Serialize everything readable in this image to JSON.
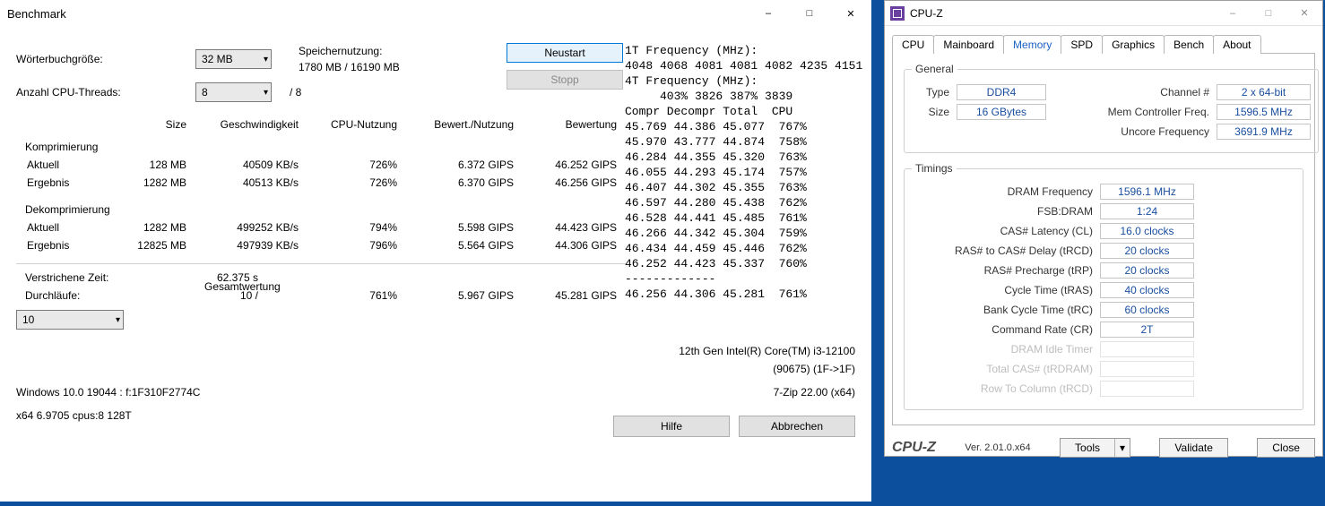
{
  "sevenzip": {
    "title": "Benchmark",
    "labels": {
      "dict": "Wörterbuchgröße:",
      "threads": "Anzahl CPU-Threads:",
      "mem_title": "Speichernutzung:",
      "mem_value": "1780 MB / 16190 MB",
      "threads_total": "/ 8",
      "neustart": "Neustart",
      "stopp": "Stopp",
      "hilfe": "Hilfe",
      "abbrechen": "Abbrechen",
      "elapsed": "Verstrichene Zeit:",
      "passes": "Durchläufe:",
      "total_rating": "Gesamtwertung"
    },
    "dict_value": "32 MB",
    "threads_value": "8",
    "passes_combo": "10",
    "headers": [
      "",
      "Size",
      "Geschwindigkeit",
      "CPU-Nutzung",
      "Bewert./Nutzung",
      "Bewertung"
    ],
    "sections": {
      "compress": "Komprimierung",
      "decompress": "Dekomprimierung"
    },
    "compress": [
      {
        "name": "Aktuell",
        "size": "128 MB",
        "speed": "40509 KB/s",
        "cpu": "726%",
        "rpu": "6.372 GIPS",
        "rating": "46.252 GIPS"
      },
      {
        "name": "Ergebnis",
        "size": "1282 MB",
        "speed": "40513 KB/s",
        "cpu": "726%",
        "rpu": "6.370 GIPS",
        "rating": "46.256 GIPS"
      }
    ],
    "decompress": [
      {
        "name": "Aktuell",
        "size": "1282 MB",
        "speed": "499252 KB/s",
        "cpu": "794%",
        "rpu": "5.598 GIPS",
        "rating": "44.423 GIPS"
      },
      {
        "name": "Ergebnis",
        "size": "12825 MB",
        "speed": "497939 KB/s",
        "cpu": "796%",
        "rpu": "5.564 GIPS",
        "rating": "44.306 GIPS"
      }
    ],
    "elapsed_value": "62.375 s",
    "passes_value": "10 /",
    "total": {
      "cpu": "761%",
      "rpu": "5.967 GIPS",
      "rating": "45.281 GIPS"
    },
    "cpuinfo1": "12th Gen Intel(R) Core(TM) i3-12100",
    "cpuinfo2": "(90675) (1F->1F)",
    "osinfo": "Windows 10.0 19044 : f:1F310F2774C",
    "zipver": "7-Zip 22.00 (x64)",
    "buildinfo": "x64 6.9705 cpus:8 128T",
    "log": "1T Frequency (MHz):\n4048 4068 4081 4081 4082 4235 4151\n4T Frequency (MHz):\n     403% 3826 387% 3839\nCompr Decompr Total  CPU\n45.769 44.386 45.077  767%\n45.970 43.777 44.874  758%\n46.284 44.355 45.320  763%\n46.055 44.293 45.174  757%\n46.407 44.302 45.355  763%\n46.597 44.280 45.438  762%\n46.528 44.441 45.485  761%\n46.266 44.342 45.304  759%\n46.434 44.459 45.446  762%\n46.252 44.423 45.337  760%\n-------------\n46.256 44.306 45.281  761%"
  },
  "cpuz": {
    "title": "CPU-Z",
    "tabs": [
      "CPU",
      "Mainboard",
      "Memory",
      "SPD",
      "Graphics",
      "Bench",
      "About"
    ],
    "active_tab": 2,
    "group_general": "General",
    "group_timings": "Timings",
    "general": {
      "type_l": "Type",
      "type_v": "DDR4",
      "size_l": "Size",
      "size_v": "16 GBytes",
      "chan_l": "Channel #",
      "chan_v": "2 x 64-bit",
      "mcf_l": "Mem Controller Freq.",
      "mcf_v": "1596.5 MHz",
      "unc_l": "Uncore Frequency",
      "unc_v": "3691.9 MHz"
    },
    "timings": [
      {
        "l": "DRAM Frequency",
        "v": "1596.1 MHz"
      },
      {
        "l": "FSB:DRAM",
        "v": "1:24"
      },
      {
        "l": "CAS# Latency (CL)",
        "v": "16.0 clocks"
      },
      {
        "l": "RAS# to CAS# Delay (tRCD)",
        "v": "20 clocks"
      },
      {
        "l": "RAS# Precharge (tRP)",
        "v": "20 clocks"
      },
      {
        "l": "Cycle Time (tRAS)",
        "v": "40 clocks"
      },
      {
        "l": "Bank Cycle Time (tRC)",
        "v": "60 clocks"
      },
      {
        "l": "Command Rate (CR)",
        "v": "2T"
      },
      {
        "l": "DRAM Idle Timer",
        "v": ""
      },
      {
        "l": "Total CAS# (tRDRAM)",
        "v": ""
      },
      {
        "l": "Row To Column (tRCD)",
        "v": ""
      }
    ],
    "footer": {
      "brand": "CPU-Z",
      "ver": "Ver. 2.01.0.x64",
      "tools": "Tools",
      "validate": "Validate",
      "close": "Close"
    }
  }
}
